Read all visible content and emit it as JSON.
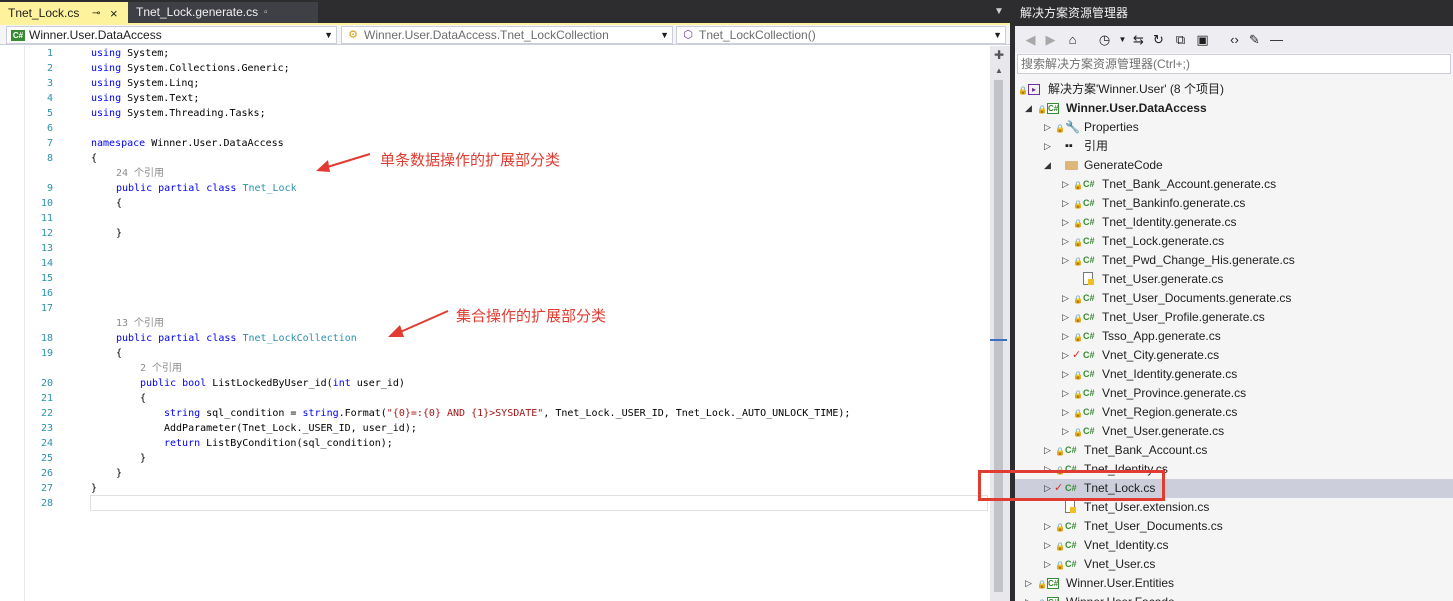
{
  "tabs": [
    {
      "label": "Tnet_Lock.cs",
      "active": true
    },
    {
      "label": "Tnet_Lock.generate.cs",
      "active": false
    }
  ],
  "navbar": {
    "project": "Winner.User.DataAccess",
    "project_icon": "C#",
    "class": "Winner.User.DataAccess.Tnet_LockCollection",
    "member": "Tnet_LockCollection()"
  },
  "code": {
    "line_numbers": [
      "1",
      "2",
      "3",
      "4",
      "5",
      "6",
      "7",
      "8",
      "9",
      "10",
      "11",
      "12",
      "13",
      "14",
      "15",
      "16",
      "17",
      "18",
      "19",
      "20",
      "21",
      "22",
      "23",
      "24",
      "25",
      "26",
      "27",
      "28"
    ],
    "lines": {
      "l1": "using System;",
      "l2": "using System.Collections.Generic;",
      "l3": "using System.Linq;",
      "l4": "using System.Text;",
      "l5": "using System.Threading.Tasks;",
      "l7": "namespace Winner.User.DataAccess",
      "l8": "{",
      "ref1": "24 个引用",
      "l9_kw": "public partial class ",
      "l9_type": "Tnet_Lock",
      "l10": "{",
      "l12": "}",
      "ref2": "13 个引用",
      "l18_kw": "public partial class ",
      "l18_type": "Tnet_LockCollection",
      "l19": "{",
      "ref3": "2 个引用",
      "l20_kw": "public bool ",
      "l20_rest": "ListLockedByUser_id(",
      "l20_kw2": "int",
      "l20_end": " user_id)",
      "l21": "{",
      "l22_kw": "string",
      "l22_mid": " sql_condition = ",
      "l22_kw2": "string",
      "l22_call": ".Format(",
      "l22_str": "\"{0}=:{0} AND {1}>SYSDATE\"",
      "l22_end": ", Tnet_Lock._USER_ID, Tnet_Lock._AUTO_UNLOCK_TIME);",
      "l23": "AddParameter(Tnet_Lock._USER_ID, user_id);",
      "l24_kw": "return",
      "l24_rest": " ListByCondition(sql_condition);",
      "l25": "}",
      "l26": "}",
      "l27": "}"
    }
  },
  "annotations": {
    "single": "单条数据操作的扩展部分类",
    "collection": "集合操作的扩展部分类"
  },
  "solution_explorer": {
    "title": "解决方案资源管理器",
    "search_placeholder": "搜索解决方案资源管理器(Ctrl+;)",
    "solution": "解决方案'Winner.User' (8 个项目)",
    "project": "Winner.User.DataAccess",
    "properties": "Properties",
    "references": "引用",
    "folder": "GenerateCode",
    "generated_files": [
      "Tnet_Bank_Account.generate.cs",
      "Tnet_Bankinfo.generate.cs",
      "Tnet_Identity.generate.cs",
      "Tnet_Lock.generate.cs",
      "Tnet_Pwd_Change_His.generate.cs",
      "Tnet_User.generate.cs",
      "Tnet_User_Documents.generate.cs",
      "Tnet_User_Profile.generate.cs",
      "Tsso_App.generate.cs",
      "Vnet_City.generate.cs",
      "Vnet_Identity.generate.cs",
      "Vnet_Province.generate.cs",
      "Vnet_Region.generate.cs",
      "Vnet_User.generate.cs"
    ],
    "files": [
      "Tnet_Bank_Account.cs",
      "Tnet_Identity.cs",
      "Tnet_Lock.cs",
      "Tnet_User.extension.cs",
      "Tnet_User_Documents.cs",
      "Vnet_Identity.cs",
      "Vnet_User.cs"
    ],
    "next_project": "Winner.User.Entities",
    "partial_project": "Winner.User.Facade"
  },
  "colors": {
    "active_tab": "#fff29d",
    "keyword": "#0000ff",
    "type": "#2b91af",
    "string": "#a31515",
    "annotation": "#e03c31",
    "selection": "#cccedb"
  }
}
